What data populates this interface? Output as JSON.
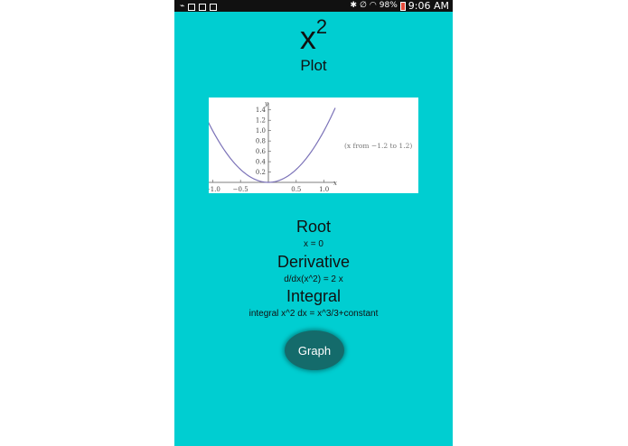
{
  "status_bar": {
    "left_icons": [
      "usb-icon",
      "image-icon",
      "photo-icon",
      "app-icon"
    ],
    "battery": "98%",
    "time": "9:06 AM"
  },
  "title": {
    "base": "x",
    "exponent": "2"
  },
  "plot_label": "Plot",
  "plot": {
    "y_axis_label": "y",
    "x_axis_label": "x",
    "y_ticks": [
      "1.4",
      "1.2",
      "1.0",
      "0.8",
      "0.6",
      "0.4",
      "0.2"
    ],
    "x_ticks": [
      "−1.0",
      "−0.5",
      "0.5",
      "1.0"
    ],
    "range_note": "(x from −1.2 to 1.2)",
    "curve_color": "#7b72b8"
  },
  "chart_data": {
    "type": "line",
    "title": "",
    "xlabel": "x",
    "ylabel": "y",
    "xlim": [
      -1.2,
      1.2
    ],
    "ylim": [
      0,
      1.5
    ],
    "x": [
      -1.2,
      -1.0,
      -0.8,
      -0.6,
      -0.4,
      -0.2,
      0,
      0.2,
      0.4,
      0.6,
      0.8,
      1.0,
      1.2
    ],
    "series": [
      {
        "values": [
          1.44,
          1.0,
          0.64,
          0.36,
          0.16,
          0.04,
          0,
          0.04,
          0.16,
          0.36,
          0.64,
          1.0,
          1.44
        ]
      }
    ],
    "x_ticks": [
      -1.0,
      -0.5,
      0.5,
      1.0
    ],
    "y_ticks": [
      0.2,
      0.4,
      0.6,
      0.8,
      1.0,
      1.2,
      1.4
    ]
  },
  "root": {
    "heading": "Root",
    "value": "x = 0"
  },
  "derivative": {
    "heading": "Derivative",
    "value": "d/dx(x^2) = 2 x"
  },
  "integral": {
    "heading": "Integral",
    "value": "integral x^2  dx = x^3/3+constant"
  },
  "graph_button": {
    "label": "Graph"
  },
  "colors": {
    "background": "#00ced1",
    "button": "#146b6b",
    "status_bar": "#111111"
  }
}
